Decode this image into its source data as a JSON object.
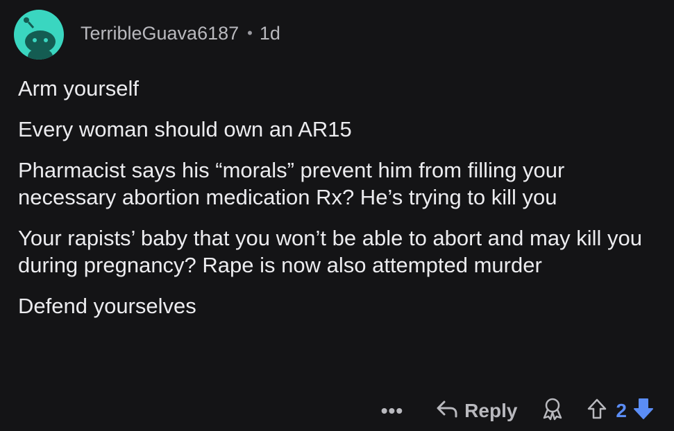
{
  "comment": {
    "author": "TerribleGuava6187",
    "separator": "•",
    "age": "1d",
    "paragraphs": [
      "Arm yourself",
      "Every woman should own an AR15",
      "Pharmacist says his “morals” prevent him from filling your necessary abortion medication Rx?  He’s trying to kill you",
      "Your rapists’ baby that you won’t be able to abort and may kill you during pregnancy?  Rape is now also attempted murder",
      "Defend yourselves"
    ]
  },
  "actions": {
    "more_label": "•••",
    "reply_label": "Reply",
    "vote_count": "2"
  },
  "colors": {
    "background": "#141416",
    "avatar": "#3ad6c0",
    "vote_active": "#5b8df5"
  },
  "icons": {
    "avatar": "snoo-avatar-icon",
    "reply": "reply-arrow-icon",
    "award": "award-icon",
    "upvote": "upvote-arrow-icon",
    "downvote": "downvote-arrow-icon"
  }
}
